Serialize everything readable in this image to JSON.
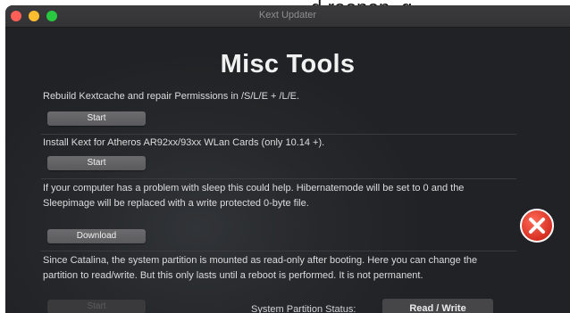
{
  "caption": {
    "text": "d reopen, g"
  },
  "window": {
    "title": "Kext Updater"
  },
  "heading": "Misc Tools",
  "sections": [
    {
      "description": "Rebuild Kextcache and repair Permissions in /S/L/E + /L/E.",
      "button_label": "Start"
    },
    {
      "description": "Install Kext for Atheros AR92xx/93xx WLan Cards (only 10.14 +).",
      "button_label": "Start"
    },
    {
      "description": "If your computer has a problem with sleep this could help. Hibernatemode will be set to 0 and the Sleepimage will be replaced with a write protected 0-byte file.",
      "button_label": "Download"
    },
    {
      "description": "Since Catalina, the system partition is mounted as read-only after booting. Here you can change the partition to read/write. But this only lasts until a reboot is performed. It is not permanent.",
      "button_label": "Start"
    }
  ],
  "status": {
    "label": "System Partition Status:",
    "value": "Read / Write"
  },
  "colors": {
    "close_red": "#e53c2f",
    "traffic_close": "#fe5f57",
    "traffic_minimize": "#febc2e",
    "traffic_maximize": "#28c840"
  },
  "icons": {
    "close": "close-circle-icon"
  }
}
